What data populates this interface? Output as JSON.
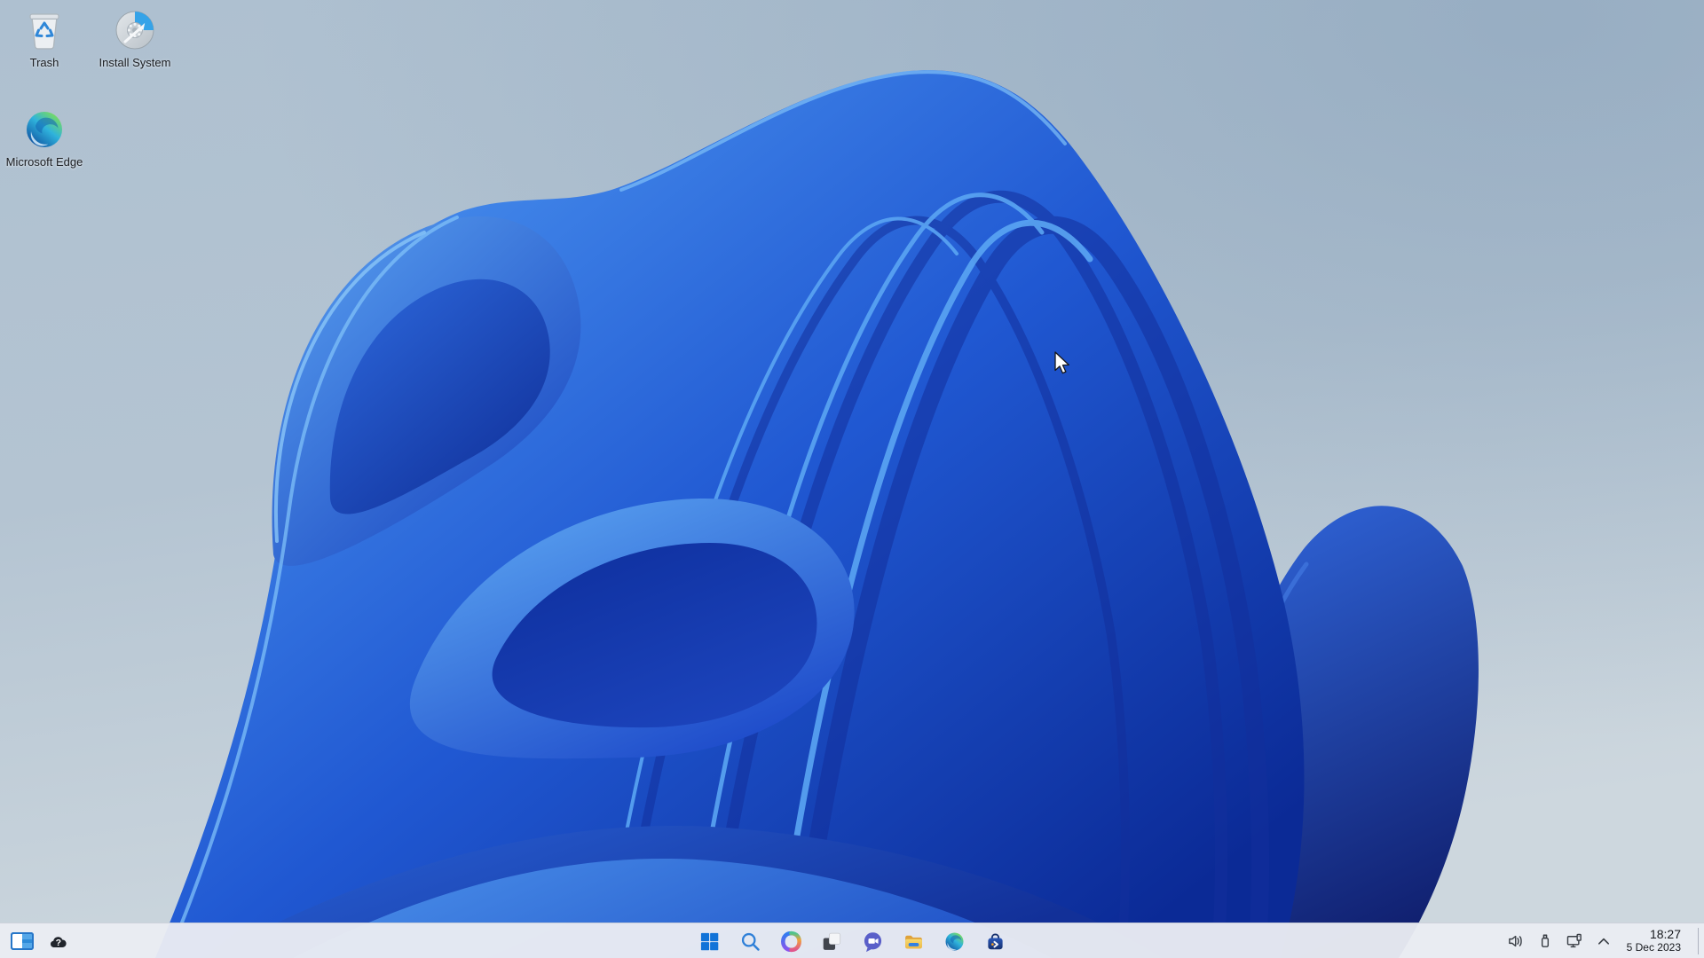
{
  "desktop_icons": [
    {
      "label": "Trash",
      "icon": "trash-icon"
    },
    {
      "label": "Install System",
      "icon": "installer-disc-icon"
    },
    {
      "label": "Microsoft Edge",
      "icon": "edge-icon"
    }
  ],
  "taskbar": {
    "left_icons": [
      {
        "name": "virtual-desktop-pager-icon"
      },
      {
        "name": "weather-unknown-cloud-icon",
        "glyph": "?"
      }
    ],
    "center_icons": [
      {
        "name": "start-icon"
      },
      {
        "name": "search-icon"
      },
      {
        "name": "copilot-icon"
      },
      {
        "name": "task-view-icon"
      },
      {
        "name": "chat-video-icon"
      },
      {
        "name": "file-explorer-icon"
      },
      {
        "name": "edge-icon"
      },
      {
        "name": "discover-store-icon"
      }
    ],
    "tray_icons": [
      {
        "name": "volume-icon"
      },
      {
        "name": "usb-device-icon"
      },
      {
        "name": "display-device-icon"
      },
      {
        "name": "tray-expand-chevron-icon"
      }
    ],
    "clock": {
      "time": "18:27",
      "date": "5 Dec 2023"
    }
  },
  "wallpaper": {
    "name": "windows-11-bloom",
    "colors": {
      "background_top": "#a7bbcc",
      "background_bottom": "#ccd6de",
      "bloom_dark": "#0c2da2",
      "bloom_mid": "#2e6adc",
      "bloom_bright": "#5aa7f4"
    }
  }
}
